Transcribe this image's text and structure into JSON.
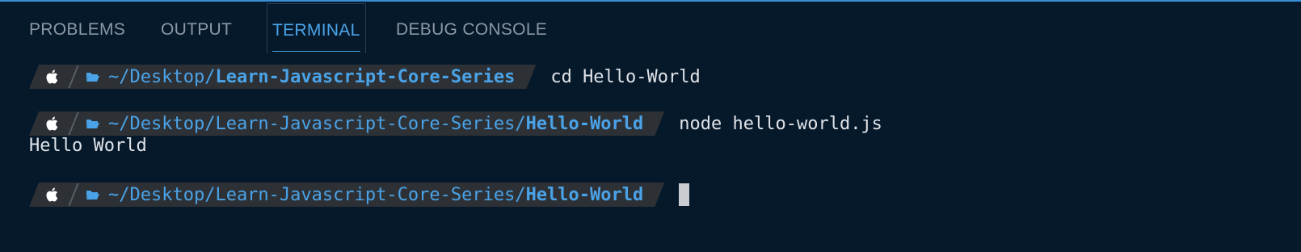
{
  "panel": {
    "tabs": [
      {
        "label": "PROBLEMS"
      },
      {
        "label": "OUTPUT"
      },
      {
        "label": "TERMINAL"
      },
      {
        "label": "DEBUG CONSOLE"
      }
    ],
    "active_tab": "TERMINAL"
  },
  "terminal": {
    "lines": [
      {
        "path_prefix": "~/Desktop/",
        "path_bold": "Learn-Javascript-Core-Series",
        "command": "cd Hello-World"
      },
      {
        "path_prefix": "~/Desktop/Learn-Javascript-Core-Series/",
        "path_bold": "Hello-World",
        "command": "node hello-world.js"
      },
      {
        "path_prefix": "~/Desktop/Learn-Javascript-Core-Series/",
        "path_bold": "Hello-World",
        "command": ""
      }
    ],
    "output": "Hello World"
  },
  "colors": {
    "background": "#06192b",
    "accent": "#4aa3e8",
    "prompt_segment": "#2d3136",
    "text": "#dfe3e8"
  },
  "icons": [
    "apple-icon",
    "folder-open-icon"
  ]
}
